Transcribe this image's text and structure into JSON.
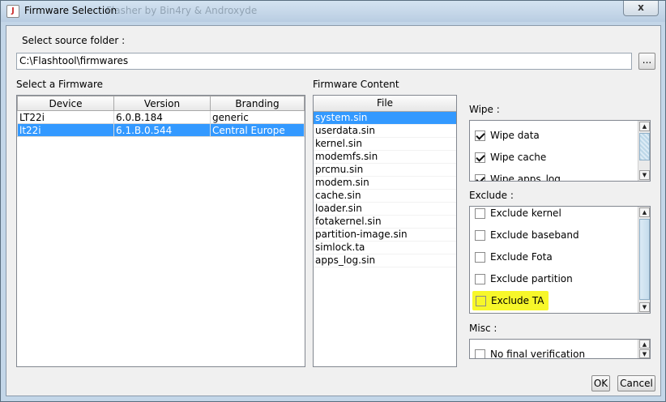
{
  "window": {
    "title": "Firmware Selection",
    "ghost_title": "Flasher by Bin4ry & Androxyde",
    "close_label": "x"
  },
  "source": {
    "label": "Select source folder :",
    "path": "C:\\Flashtool\\firmwares",
    "browse_label": "..."
  },
  "firmwares": {
    "label": "Select a Firmware",
    "columns": [
      "Device",
      "Version",
      "Branding"
    ],
    "rows": [
      {
        "device": "LT22i",
        "version": "6.0.B.184",
        "branding": "generic",
        "selected": false
      },
      {
        "device": "lt22i",
        "version": "6.1.B.0.544",
        "branding": "Central Europe",
        "selected": true
      }
    ]
  },
  "content": {
    "label": "Firmware Content",
    "column": "File",
    "files": [
      "system.sin",
      "userdata.sin",
      "kernel.sin",
      "modemfs.sin",
      "prcmu.sin",
      "modem.sin",
      "cache.sin",
      "loader.sin",
      "fotakernel.sin",
      "partition-image.sin",
      "simlock.ta",
      "apps_log.sin"
    ],
    "selected_index": 0
  },
  "wipe": {
    "label": "Wipe :",
    "items": [
      {
        "label": "Wipe data",
        "checked": true
      },
      {
        "label": "Wipe cache",
        "checked": true
      },
      {
        "label": "Wipe apps_log",
        "checked": true
      }
    ]
  },
  "exclude": {
    "label": "Exclude :",
    "items": [
      {
        "label": "Exclude kernel",
        "checked": false
      },
      {
        "label": "Exclude baseband",
        "checked": false
      },
      {
        "label": "Exclude Fota",
        "checked": false
      },
      {
        "label": "Exclude partition",
        "checked": false
      },
      {
        "label": "Exclude TA",
        "checked": false
      }
    ],
    "highlight_color": "#f7f72a"
  },
  "misc": {
    "label": "Misc :",
    "items": [
      {
        "label": "No final verification",
        "checked": false
      }
    ]
  },
  "buttons": {
    "ok": "OK",
    "cancel": "Cancel"
  },
  "colors": {
    "selection": "#3399ff",
    "titlebar": "#c3d6e8"
  }
}
